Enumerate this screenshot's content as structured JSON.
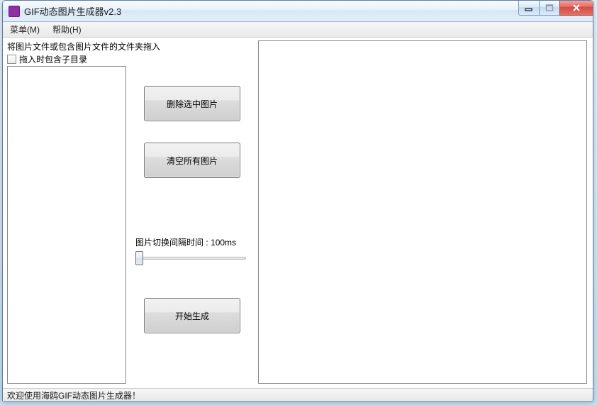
{
  "window": {
    "title": "GIF动态图片生成器v2.3",
    "icon_text": "GIF"
  },
  "menu": {
    "menu_label": "菜单(M)",
    "help_label": "帮助(H)"
  },
  "labels": {
    "drag_hint": "将图片文件或包含图片文件的文件夹拖入",
    "include_subdir": "拖入时包含子目录"
  },
  "buttons": {
    "delete_selected": "删除选中图片",
    "clear_all": "清空所有图片",
    "start_generate": "开始生成"
  },
  "interval": {
    "label_prefix": "图片切换间隔时间 : ",
    "value_text": "100ms"
  },
  "status": {
    "text": "欢迎使用海鸥GIF动态图片生成器！"
  }
}
